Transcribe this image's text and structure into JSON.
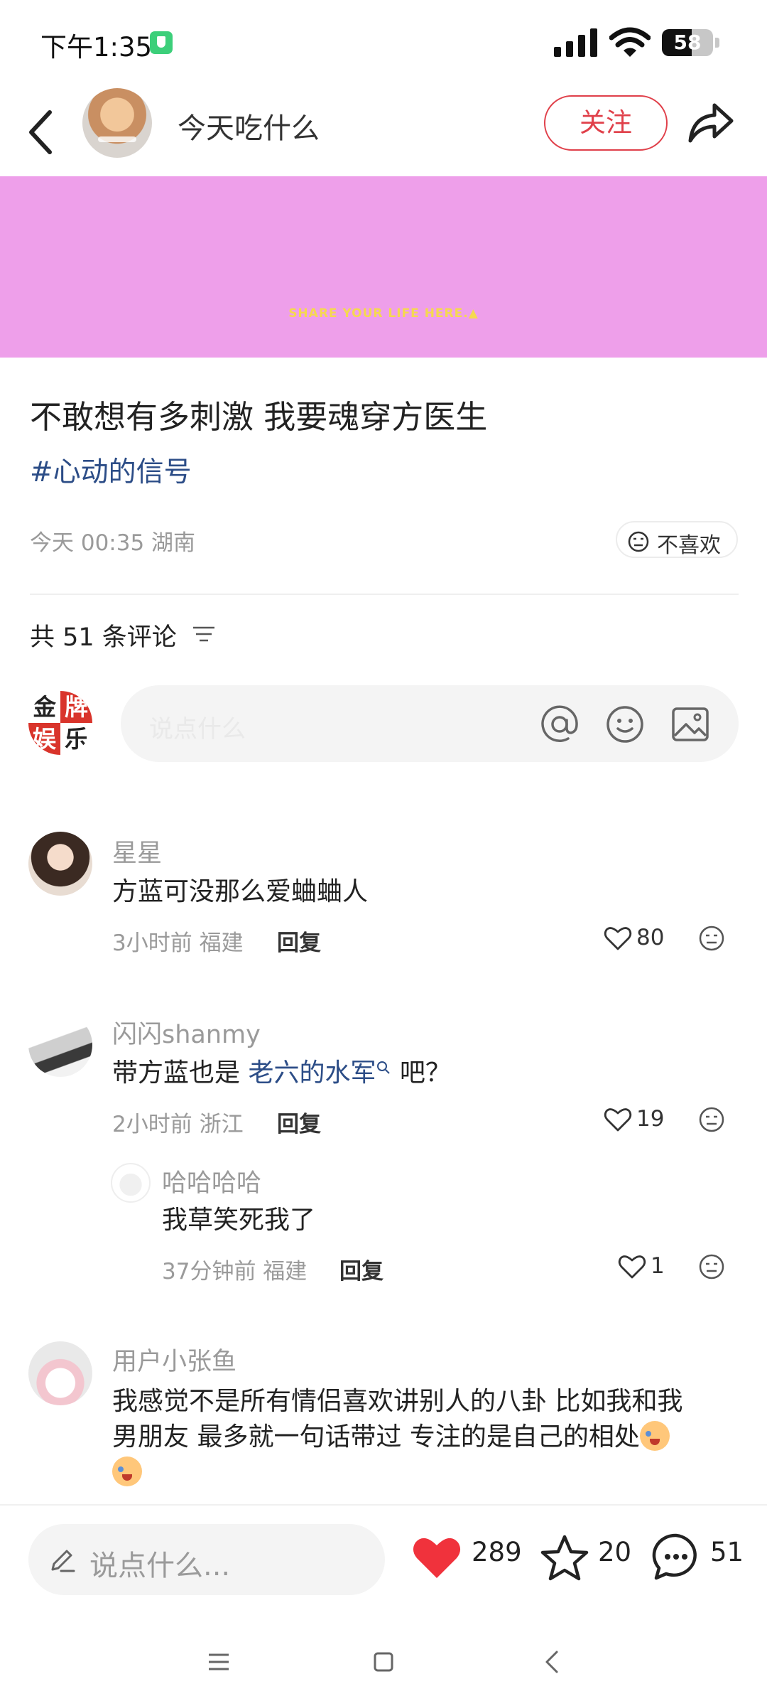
{
  "status_bar": {
    "time": "下午1:35",
    "battery": "58",
    "battery_level": 0.58
  },
  "header": {
    "author_name": "今天吃什么",
    "follow_label": "关注"
  },
  "banner": {
    "text": "SHARE YOUR LIFE HERE.▲",
    "color": "#ee9fea"
  },
  "post": {
    "title": "不敢想有多刺激 我要魂穿方医生",
    "tag": "#心动的信号",
    "meta": "今天 00:35 湖南",
    "dislike_label": "不喜欢"
  },
  "comments_header": {
    "count_label": "共 51 条评论"
  },
  "comment_input": {
    "avatar_chars": [
      "金",
      "牌",
      "娱",
      "乐"
    ],
    "placeholder": "说点什么"
  },
  "comments": [
    {
      "user": "星星",
      "text": "方蓝可没那么爱蛐蛐人",
      "meta": "3小时前 福建",
      "reply_label": "回复",
      "likes": "80"
    },
    {
      "user": "闪闪shanmy",
      "text_before": "带方蓝也是 ",
      "link": "老六的水军",
      "text_after": " 吧？",
      "meta": "2小时前 浙江",
      "reply_label": "回复",
      "likes": "19",
      "replies": [
        {
          "user": "哈哈哈哈",
          "text": "我草笑死我了",
          "meta": "37分钟前 福建",
          "reply_label": "回复",
          "likes": "1"
        }
      ]
    },
    {
      "user": "用户小张鱼",
      "text_line1": "我感觉不是所有情侣喜欢讲别人的八卦 比如我和我",
      "text_line2": "男朋友 最多就一句话带过 专注的是自己的相处"
    }
  ],
  "bottom_bar": {
    "placeholder": "说点什么...",
    "likes": "289",
    "stars": "20",
    "comments": "51",
    "like_color": "#f0323c"
  },
  "icons": [
    "back-icon",
    "share-icon",
    "at-icon",
    "emoji-icon",
    "image-icon",
    "heart-icon",
    "star-icon",
    "comment-icon",
    "pen-icon",
    "filter-icon",
    "dislike-face-icon",
    "menu-icon",
    "home-icon",
    "nav-back-icon"
  ]
}
